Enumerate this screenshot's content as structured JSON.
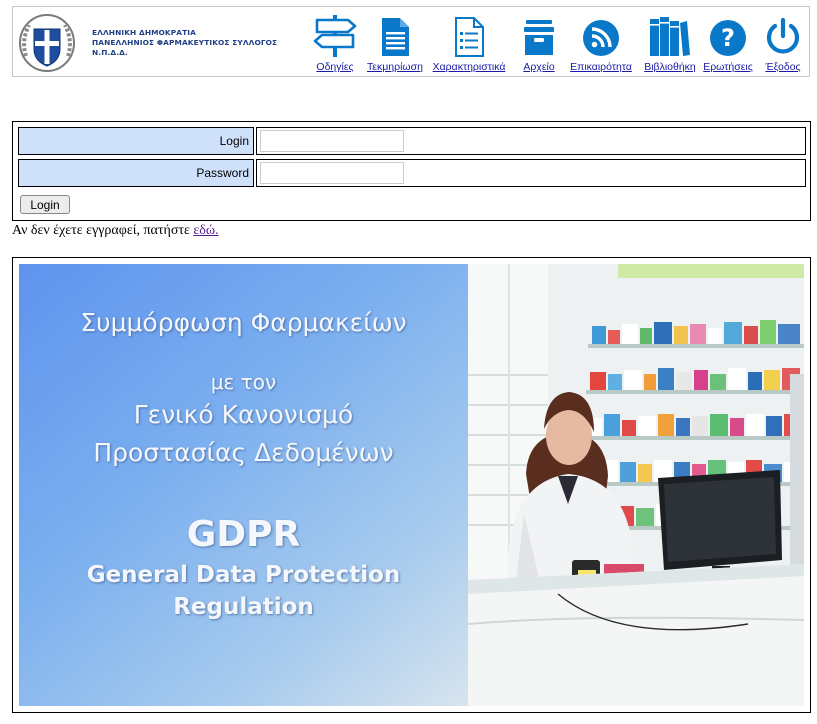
{
  "header": {
    "org_lines": [
      "ΕΛΛΗΝΙΚΗ ΔΗΜΟΚΡΑΤΙΑ",
      "ΠΑΝΕΛΛΗΝΙΟΣ ΦΑΡΜΑΚΕΥΤΙΚΟΣ ΣΥΛΛΟΓΟΣ",
      "Ν.Π.Δ.Δ."
    ],
    "nav": [
      {
        "label": "Οδηγίες",
        "icon": "signpost-icon"
      },
      {
        "label": "Τεκμηρίωση",
        "icon": "document-icon"
      },
      {
        "label": "Χαρακτηριστικά",
        "icon": "checklist-icon"
      },
      {
        "label": "Αρχείο",
        "icon": "archive-box-icon"
      },
      {
        "label": "Επικαιρότητα",
        "icon": "rss-icon"
      },
      {
        "label": "Βιβλιοθήκη",
        "icon": "books-icon"
      },
      {
        "label": "Ερωτήσεις",
        "icon": "question-icon"
      },
      {
        "label": "Έξοδος",
        "icon": "power-icon"
      }
    ]
  },
  "colors": {
    "accent": "#0a78c8",
    "label_bg": "#cfe0fb",
    "link": "#1a1aa6"
  },
  "login_form": {
    "login_label": "Login",
    "password_label": "Password",
    "login_value": "",
    "password_value": "",
    "submit_label": "Login"
  },
  "register": {
    "text": "Αν δεν έχετε εγγραφεί, πατήστε ",
    "link_text": "εδώ."
  },
  "banner": {
    "line1": "Συμμόρφωση Φαρμακείων",
    "line2": "με τον",
    "line3": "Γενικό Κανονισμό",
    "line4": "Προστασίας Δεδομένων",
    "line5": "GDPR",
    "line6": "General Data Protection",
    "line7": "Regulation"
  }
}
